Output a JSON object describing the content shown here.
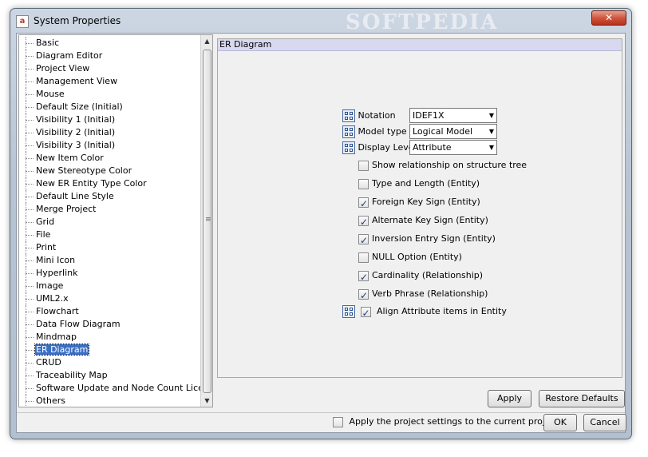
{
  "window": {
    "title": "System Properties",
    "app_icon_text": "a",
    "watermark": "SOFTPEDIA",
    "close_label": "✕"
  },
  "sidebar": {
    "items": [
      "Basic",
      "Diagram Editor",
      "Project View",
      "Management View",
      "Mouse",
      "Default Size (Initial)",
      "Visibility 1 (Initial)",
      "Visibility 2 (Initial)",
      "Visibility 3 (Initial)",
      "New Item Color",
      "New Stereotype Color",
      "New ER Entity Type Color",
      "Default Line Style",
      "Merge Project",
      "Grid",
      "File",
      "Print",
      "Mini Icon",
      "Hyperlink",
      "Image",
      "UML2.x",
      "Flowchart",
      "Data Flow Diagram",
      "Mindmap",
      "ER Diagram",
      "CRUD",
      "Traceability Map",
      "Software Update and Node Count License",
      "Others"
    ],
    "selected": "ER Diagram"
  },
  "panel": {
    "header": "ER Diagram",
    "notation": {
      "label": "Notation",
      "value": "IDEF1X"
    },
    "model_type": {
      "label": "Model type",
      "value": "Logical Model"
    },
    "display_level": {
      "label": "Display Level",
      "value": "Attribute"
    },
    "checkboxes": [
      {
        "label": "Show relationship on structure tree",
        "checked": false
      },
      {
        "label": "Type and Length (Entity)",
        "checked": false
      },
      {
        "label": "Foreign Key Sign (Entity)",
        "checked": true
      },
      {
        "label": "Alternate Key Sign (Entity)",
        "checked": true
      },
      {
        "label": "Inversion Entry Sign (Entity)",
        "checked": true
      },
      {
        "label": "NULL Option (Entity)",
        "checked": false
      },
      {
        "label": "Cardinality (Relationship)",
        "checked": true
      },
      {
        "label": "Verb Phrase (Relationship)",
        "checked": true
      }
    ],
    "align": {
      "label": "Align Attribute items in Entity",
      "checked": true
    }
  },
  "buttons": {
    "apply": "Apply",
    "restore": "Restore Defaults",
    "ok": "OK",
    "cancel": "Cancel"
  },
  "project_settings": {
    "label": "Apply the project settings to the current project",
    "checked": false
  }
}
